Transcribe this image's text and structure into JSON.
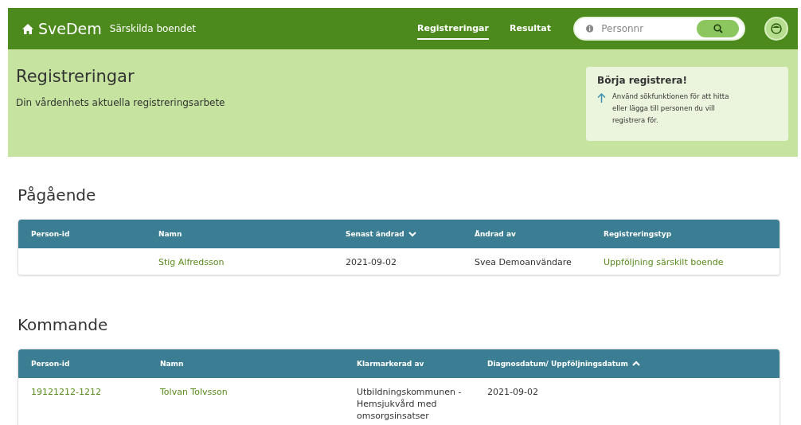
{
  "header": {
    "brand": "SveDem",
    "subtitle": "Särskilda boendet",
    "nav": [
      {
        "label": "Registreringar",
        "selected": true
      },
      {
        "label": "Resultat",
        "selected": false
      }
    ],
    "search": {
      "placeholder": "Personnr"
    }
  },
  "banner": {
    "title": "Registreringar",
    "description": "Din vårdenhets aktuella registreringsarbete",
    "hint": {
      "title": "Börja registrera!",
      "text": "Använd sökfunktionen för att hitta eller lägga till personen du vill registrera för."
    }
  },
  "sections": [
    {
      "title": "Pågående",
      "columns": [
        {
          "label": "Person-id",
          "sorted": false
        },
        {
          "label": "Namn",
          "sorted": false
        },
        {
          "label": "Senast ändrad",
          "sorted": true,
          "descending": true
        },
        {
          "label": "Ändrad av",
          "sorted": false
        },
        {
          "label": "Registreringstyp",
          "sorted": false
        }
      ],
      "rows": [
        [
          null,
          {
            "text": "Stig Alfredsson",
            "link": true
          },
          {
            "text": "2021-09-02",
            "link": false
          },
          {
            "text": "Svea Demoanvändare",
            "link": false
          },
          {
            "text": "Uppföljning särskilt boende",
            "link": true
          }
        ]
      ]
    },
    {
      "title": "Kommande",
      "columns": [
        {
          "label": "Person-id",
          "sorted": false
        },
        {
          "label": "Namn",
          "sorted": false
        },
        {
          "label": "Klarmarkerad av",
          "sorted": false
        },
        {
          "label": "Diagnosdatum/ Uppföljningsdatum",
          "sorted": true,
          "descending": false
        }
      ],
      "rows": [
        [
          {
            "text": "19121212-1212",
            "link": true
          },
          {
            "text": "Tolvan Tolvsson",
            "link": true
          },
          {
            "text": "Utbildningskommunen - Hemsjukvård med omsorgsinsatser",
            "link": false
          },
          {
            "text": "2021-09-02",
            "link": false
          }
        ]
      ]
    }
  ]
}
